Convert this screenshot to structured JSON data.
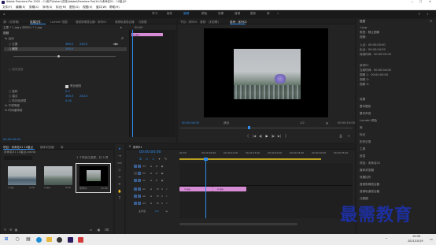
{
  "titlebar": {
    "title": "Adobe Premiere Pro 2020 - C:\\用户\\Ashan\\文档\\Adobe\\Premiere Pro\\14.0\\未命名01 - 10星点*",
    "controls": [
      "—",
      "□",
      "✕"
    ]
  },
  "menubar": [
    "文件(F)",
    "编辑(E)",
    "剪辑(C)",
    "序列(S)",
    "标记(M)",
    "图形(G)",
    "视图(V)",
    "窗口(W)",
    "帮助(H)"
  ],
  "workspaces": [
    "学习",
    "组件",
    "编辑",
    "颜色",
    "效果",
    "音频",
    "图形",
    "库",
    "»"
  ],
  "effect_controls": {
    "tabs": [
      "源：(无剪辑)",
      "效果控件",
      "Lumetri 范围",
      "音频剪辑混合器：序列01",
      "音频轨道混合器",
      "元数据"
    ],
    "source_path": "主要 * 1.jpg  ▸  序列01 * 1.jpg",
    "timecode_head": "00:00",
    "clip_label": "1.jpg",
    "sections": {
      "video": "视频",
      "motion": "fx 运动",
      "position": {
        "label": "○ 位置",
        "x": "360.0",
        "y": "240.0"
      },
      "scale": {
        "label": "○ 缩放",
        "value": "105.0"
      },
      "scale_width": "○ 缩放宽度",
      "uniform": "等比缩放",
      "rotation": {
        "label": "○ 旋转",
        "value": "0.0"
      },
      "anchor": {
        "label": "○ 锚点",
        "x": "360.0",
        "y": "240.0"
      },
      "anti_flicker": {
        "label": "○ 防闪烁滤镜",
        "value": "0.00"
      },
      "opacity": "fx 不透明度",
      "time_remap": "fx 时间重映射"
    },
    "timecode": "00:00:00:00"
  },
  "program_monitor": {
    "tabs": [
      "节目：序列01",
      "音频：(无剪辑)",
      "参考：序列01"
    ],
    "timecode_left": "00:00:04:00",
    "fit": "适合",
    "quality": "1/2",
    "timecode_right": "00:00:10:00",
    "transport": [
      "{",
      "|◀",
      "◀|",
      "▶",
      "|▶",
      "▶|",
      "}",
      "⇄",
      "⎙",
      "+"
    ]
  },
  "project": {
    "tabs": [
      "项目：未命名01 10星点",
      "媒体浏览器",
      "库"
    ],
    "breadcrumb": "未命名01 10星点.prproj",
    "item_count": "1 个项目已选择，共 3 项",
    "items": [
      {
        "name": "1.jpg",
        "duration": "4:29"
      },
      {
        "name": "2.jpg",
        "duration": "4:29"
      },
      {
        "name": "序列01",
        "duration": "10:00"
      }
    ]
  },
  "timeline": {
    "tab": "序列01",
    "timecode": "00:00:04:00",
    "ruler": [
      "00:00",
      "00:00:05:00",
      "00:00:10:00",
      "00:00:15:00",
      "00:00:20:00",
      "00:00:25:00",
      "00:00:30:00",
      "00:00:35:00"
    ],
    "tracks": [
      "V3",
      "V2",
      "V1",
      "A1",
      "A2",
      "A3",
      "主声道"
    ],
    "master_value": "0.0",
    "clips": [
      "1.jpg",
      "2.jpg"
    ]
  },
  "info_panel": {
    "header": "信息",
    "lines": [
      "1.jpg",
      "类型：静止图像",
      "视频：",
      "",
      "入点：00:00:00:00",
      "出点：00:00:04:29",
      "持续时间：00:00:05:00",
      "",
      "序列01",
      "当前时间：00:00:04:00",
      "视频 1：00:00:00:00",
      "视频 2：",
      "视频 3："
    ],
    "panels": [
      "效果",
      "基本图形",
      "基本声音",
      "Lumetri 颜色",
      "库",
      "标记",
      "历史记录",
      "工具",
      "信息",
      "项目：未命名01",
      "媒体浏览器",
      "效果控件",
      "音频剪辑混合器",
      "音频轨道混合器",
      "元数据"
    ]
  },
  "watermark": "最需教育",
  "taskbar": {
    "time": "15:06",
    "date": "2021/10/19"
  },
  "colors": {
    "accent": "#2d8ceb",
    "clip": "#d68bd5",
    "panel": "#232323",
    "track_control_on": "#3a5d8f"
  }
}
